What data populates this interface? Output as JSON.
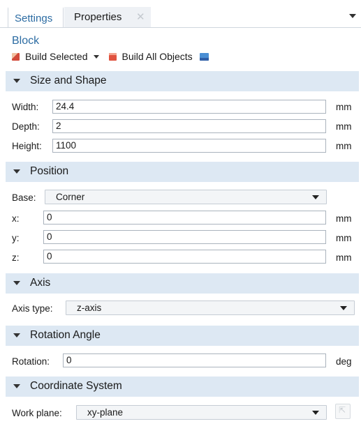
{
  "tabs": [
    {
      "label": "Settings"
    },
    {
      "label": "Properties",
      "close": "✕"
    }
  ],
  "node_title": "Block",
  "toolbar": {
    "build_selected": "Build Selected",
    "build_all": "Build All Objects"
  },
  "sections": {
    "size_shape": {
      "title": "Size and Shape",
      "width_label": "Width:",
      "width_value": "24.4",
      "depth_label": "Depth:",
      "depth_value": "2",
      "height_label": "Height:",
      "height_value": "1100",
      "unit": "mm"
    },
    "position": {
      "title": "Position",
      "base_label": "Base:",
      "base_value": "Corner",
      "x_label": "x:",
      "x_value": "0",
      "y_label": "y:",
      "y_value": "0",
      "z_label": "z:",
      "z_value": "0",
      "unit": "mm"
    },
    "axis": {
      "title": "Axis",
      "type_label": "Axis type:",
      "type_value": "z-axis"
    },
    "rotation": {
      "title": "Rotation Angle",
      "label": "Rotation:",
      "value": "0",
      "unit": "deg"
    },
    "coord": {
      "title": "Coordinate System",
      "label": "Work plane:",
      "value": "xy-plane"
    }
  },
  "colors": {
    "accent": "#2c6ca3",
    "section_bg": "#dde8f3"
  }
}
